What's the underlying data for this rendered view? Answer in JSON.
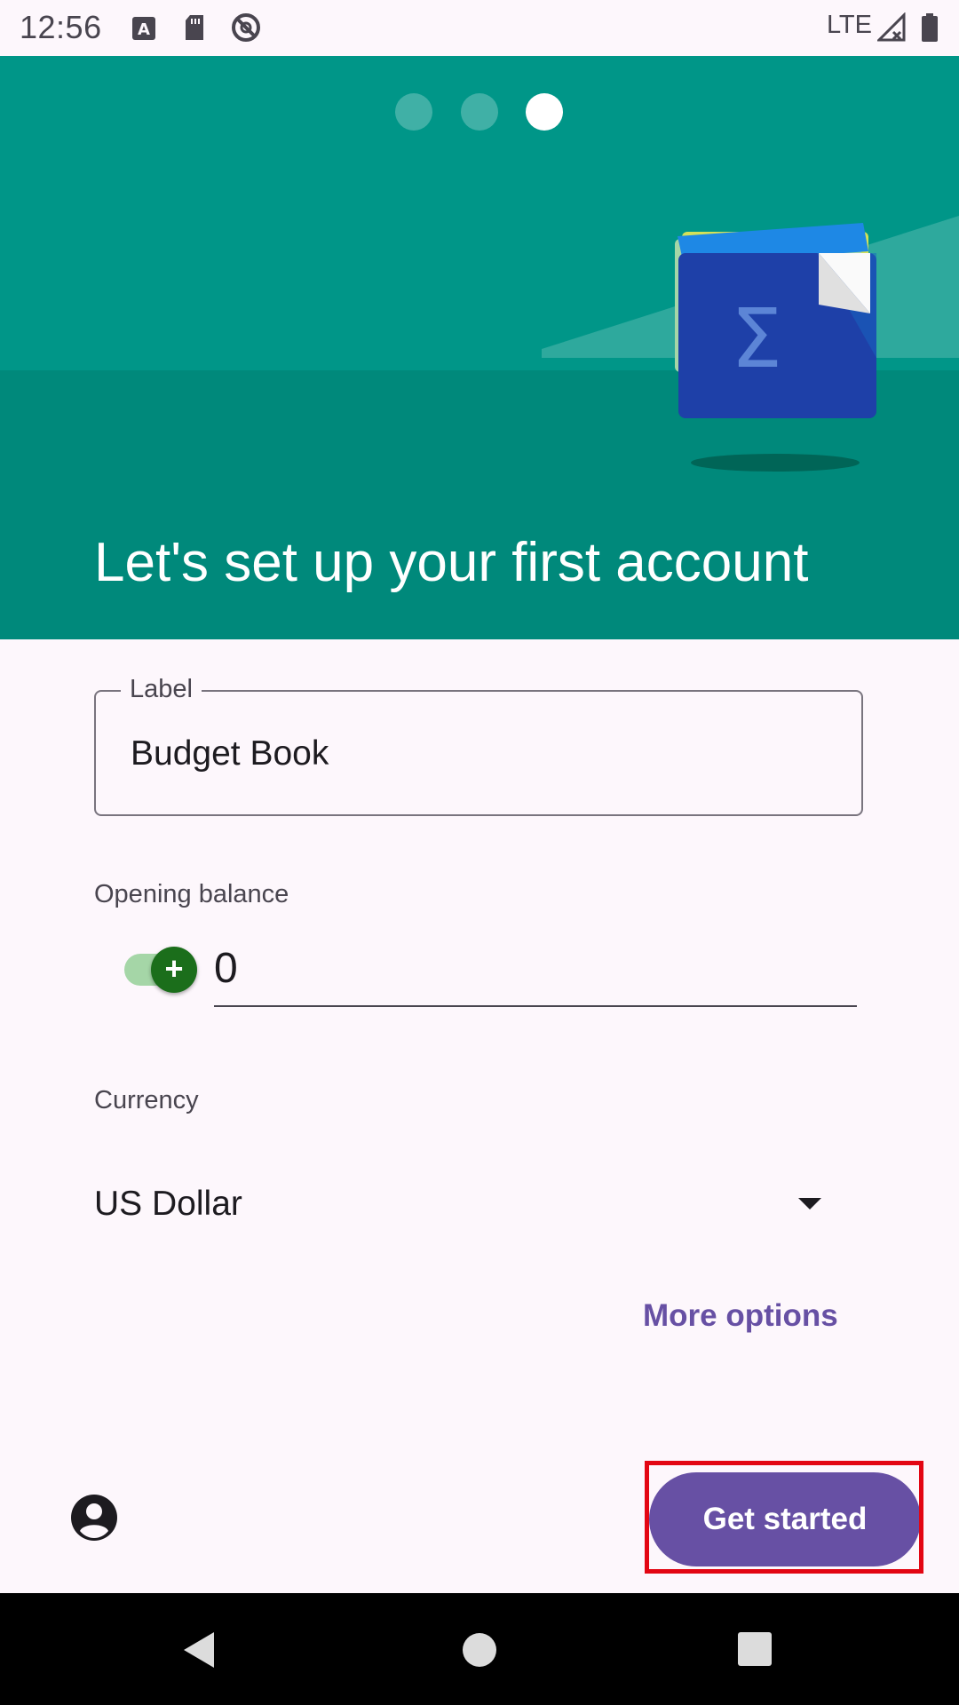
{
  "status_bar": {
    "time": "12:56",
    "network": "LTE",
    "icons": [
      "keyboard-a-icon",
      "sd-card-icon",
      "do-not-disturb-icon",
      "signal-icon",
      "battery-icon"
    ]
  },
  "header": {
    "page_indicator": {
      "count": 3,
      "active_index": 2
    },
    "title": "Let's set up your first account",
    "colors": {
      "top": "#009688",
      "bottom": "#00897b"
    }
  },
  "form": {
    "label_field": {
      "label": "Label",
      "value": "Budget Book"
    },
    "opening_balance": {
      "label": "Opening balance",
      "sign_symbol": "+",
      "value": "0"
    },
    "currency": {
      "label": "Currency",
      "value": "US Dollar"
    },
    "more_options": "More options"
  },
  "footer": {
    "get_started": "Get started"
  },
  "nav_bar": {
    "icons": [
      "back-icon",
      "home-icon",
      "recents-icon"
    ]
  },
  "colors": {
    "accent": "#6750a4",
    "highlight": "#e30613",
    "switch_on": "#1b6e1b"
  }
}
